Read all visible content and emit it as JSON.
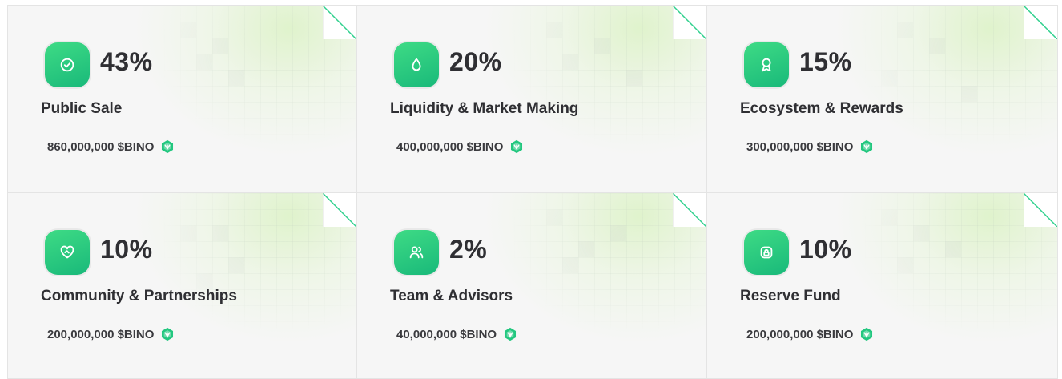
{
  "colors": {
    "accent": "#22c77f",
    "card_background": "#f6f6f6",
    "text": "#2f2f33"
  },
  "allocations": [
    {
      "percent": "43%",
      "title": "Public Sale",
      "amount": "860,000,000 $BINO",
      "icon": "check-circle-icon"
    },
    {
      "percent": "20%",
      "title": "Liquidity & Market Making",
      "amount": "400,000,000 $BINO",
      "icon": "droplet-icon"
    },
    {
      "percent": "15%",
      "title": "Ecosystem & Rewards",
      "amount": "300,000,000 $BINO",
      "icon": "award-icon"
    },
    {
      "percent": "10%",
      "title": "Community & Partnerships",
      "amount": "200,000,000 $BINO",
      "icon": "heart-handshake-icon"
    },
    {
      "percent": "2%",
      "title": "Team & Advisors",
      "amount": "40,000,000 $BINO",
      "icon": "users-icon"
    },
    {
      "percent": "10%",
      "title": "Reserve Fund",
      "amount": "200,000,000 $BINO",
      "icon": "lock-icon"
    }
  ]
}
